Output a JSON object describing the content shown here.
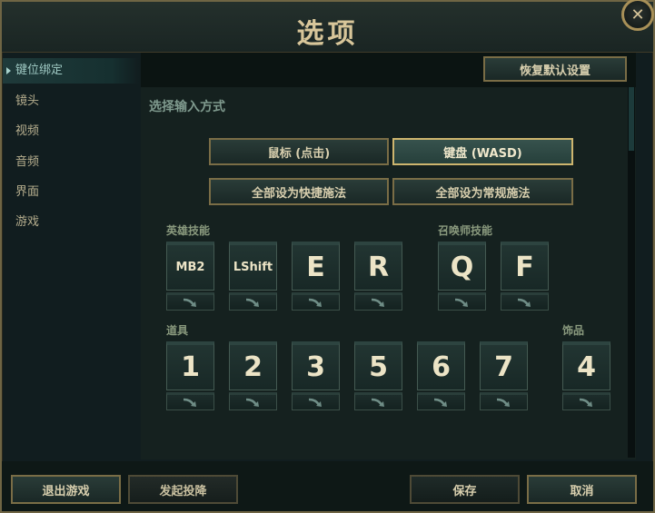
{
  "window": {
    "title": "选项",
    "close_glyph": "✕"
  },
  "sidebar": {
    "items": [
      {
        "label": "键位绑定",
        "active": true
      },
      {
        "label": "镜头",
        "active": false
      },
      {
        "label": "视频",
        "active": false
      },
      {
        "label": "音频",
        "active": false
      },
      {
        "label": "界面",
        "active": false
      },
      {
        "label": "游戏",
        "active": false
      }
    ]
  },
  "main": {
    "restore_defaults_label": "恢复默认设置",
    "input_method_title": "选择输入方式",
    "input_modes": [
      {
        "label": "鼠标 (点击)",
        "selected": false
      },
      {
        "label": "键盘 (WASD)",
        "selected": true
      }
    ],
    "cast_buttons": [
      {
        "label": "全部设为快捷施法"
      },
      {
        "label": "全部设为常规施法"
      }
    ],
    "champion_abilities": {
      "label": "英雄技能",
      "keys": [
        "MB2",
        "LShift",
        "E",
        "R"
      ]
    },
    "summoner_spells": {
      "label": "召唤师技能",
      "keys": [
        "Q",
        "F"
      ]
    },
    "items": {
      "label": "道具",
      "keys": [
        "1",
        "2",
        "3",
        "5",
        "6",
        "7"
      ]
    },
    "trinket": {
      "label": "饰品",
      "keys": [
        "4"
      ]
    }
  },
  "footer": {
    "exit_game_label": "退出游戏",
    "surrender_label": "发起投降",
    "save_label": "保存",
    "cancel_label": "取消"
  },
  "colors": {
    "accent_gold": "#cdb56e",
    "text_gold": "#d8c69a",
    "panel": "#15211f"
  },
  "icons": {
    "quick_cast_arrow": "curved-arrow-icon"
  }
}
